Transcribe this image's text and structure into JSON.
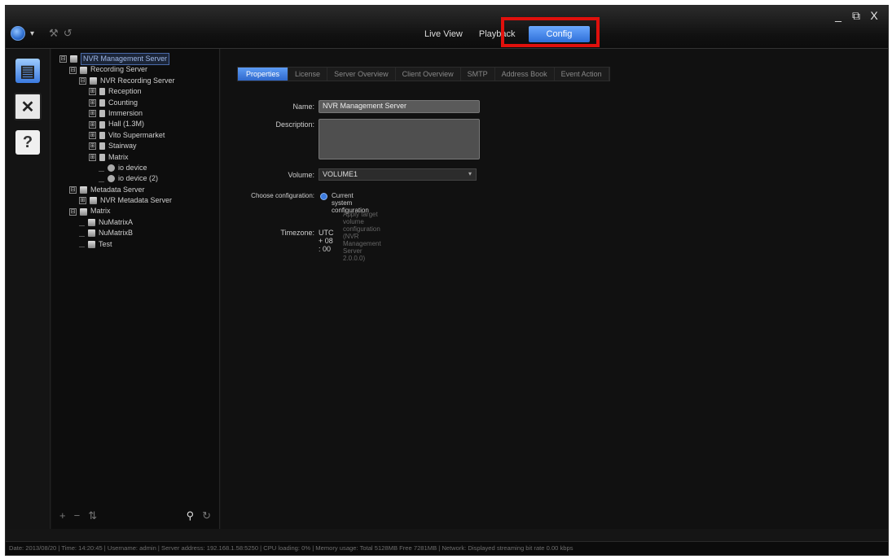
{
  "window_controls": {
    "minimize": "_",
    "restore": "⧉",
    "close": "X"
  },
  "main_tabs": [
    {
      "label": "Live View"
    },
    {
      "label": "Playback"
    },
    {
      "label": "Config"
    }
  ],
  "tree": [
    {
      "label": "NVR Management Server",
      "level": 0,
      "expander": "⊟"
    },
    {
      "label": "Recording Server",
      "level": 1,
      "expander": "⊟"
    },
    {
      "label": "NVR Recording Server",
      "level": 2,
      "expander": "⊟"
    },
    {
      "label": "Reception",
      "level": 3,
      "expander": "⊞"
    },
    {
      "label": "Counting",
      "level": 3,
      "expander": "⊞"
    },
    {
      "label": "Immersion",
      "level": 3,
      "expander": "⊞"
    },
    {
      "label": "Hall (1.3M)",
      "level": 3,
      "expander": "⊞"
    },
    {
      "label": "Vito Supermarket",
      "level": 3,
      "expander": "⊞"
    },
    {
      "label": "Stairway",
      "level": 3,
      "expander": "⊞"
    },
    {
      "label": "Matrix",
      "level": 3,
      "expander": "⊞"
    },
    {
      "label": "io device",
      "level": 4,
      "expander": ""
    },
    {
      "label": "io device (2)",
      "level": 4,
      "expander": ""
    },
    {
      "label": "Metadata Server",
      "level": 1,
      "expander": "⊟"
    },
    {
      "label": "NVR Metadata Server",
      "level": 2,
      "expander": "⊞"
    },
    {
      "label": "Matrix",
      "level": 1,
      "expander": "⊟"
    },
    {
      "label": "NuMatrixA",
      "level": 2,
      "expander": ""
    },
    {
      "label": "NuMatrixB",
      "level": 2,
      "expander": ""
    },
    {
      "label": "Test",
      "level": 2,
      "expander": ""
    }
  ],
  "config_tabs": [
    {
      "label": "Properties"
    },
    {
      "label": "License"
    },
    {
      "label": "Server Overview"
    },
    {
      "label": "Client Overview"
    },
    {
      "label": "SMTP"
    },
    {
      "label": "Address Book"
    },
    {
      "label": "Event Action"
    }
  ],
  "form": {
    "name_label": "Name:",
    "name_value": "NVR Management Server",
    "description_label": "Description:",
    "description_value": "",
    "volume_label": "Volume:",
    "volume_value": "VOLUME1",
    "choose_config_label": "Choose configuration:",
    "current_config_label": "Current system configuration",
    "apply_note": "Apply target volume configuration (NVR Management Server 2.0.0.0)",
    "timezone_label": "Timezone:",
    "timezone_value": "UTC + 08 : 00"
  },
  "status_bar": "Date: 2013/08/20  |  Time: 14:20:45  |  Username: admin  |  Server address: 192.168.1.58:5250  |  CPU loading: 0%  |  Memory usage: Total 5128MB  Free 7281MB  |  Network: Displayed streaming bit rate    0.00 kbps",
  "colors": {
    "accent": "#3b7be0",
    "highlight": "#e0100c"
  }
}
